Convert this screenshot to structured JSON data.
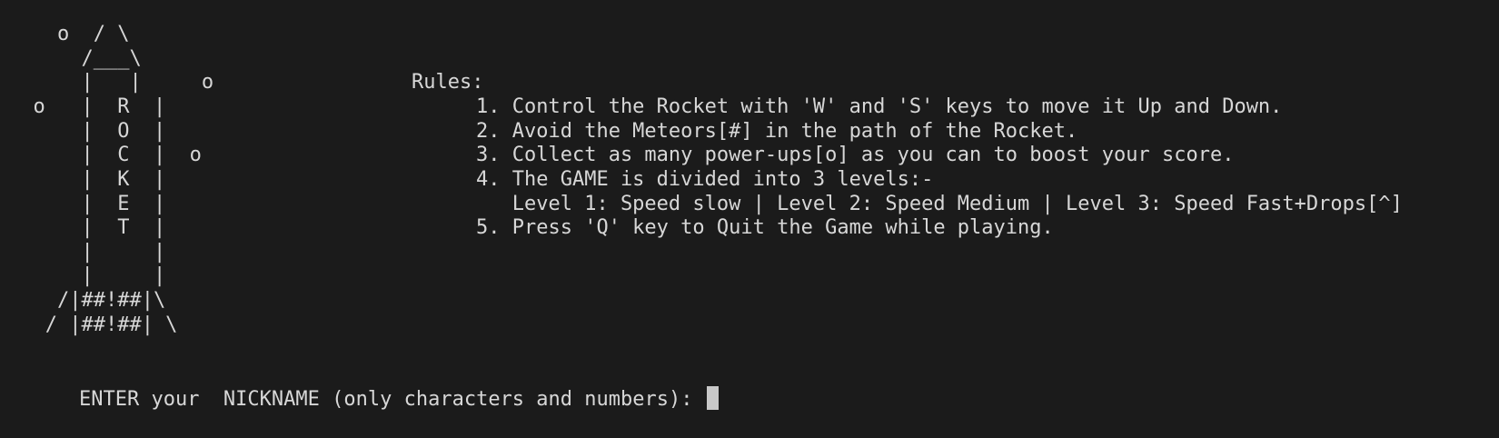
{
  "rocket_art": [
    "         ^",
    "    o  / \\",
    "      /___\\",
    "      |   |     o",
    "  o   |  R  |",
    "      |  O  |",
    "      |  C  |  o",
    "      |  K  |",
    "      |  E  |",
    "      |  T  |",
    "      |     |",
    "      |     |",
    "    /|##!##|\\",
    "   / |##!##| \\"
  ],
  "rules": {
    "heading": "Rules:",
    "items": [
      "1. Control the Rocket with 'W' and 'S' keys to move it Up and Down.",
      "2. Avoid the Meteors[#] in the path of the Rocket.",
      "3. Collect as many power-ups[o] as you can to boost your score.",
      "4. The GAME is divided into 3 levels:-",
      "   Level 1: Speed slow | Level 2: Speed Medium | Level 3: Speed Fast+Drops[^]",
      "5. Press 'Q' key to Quit the Game while playing."
    ]
  },
  "prompt": {
    "text": "ENTER your  NICKNAME (only characters and numbers): "
  },
  "colors": {
    "background": "#1b1b1b",
    "foreground": "#d7d7d7",
    "cursor": "#c8c8c8"
  }
}
